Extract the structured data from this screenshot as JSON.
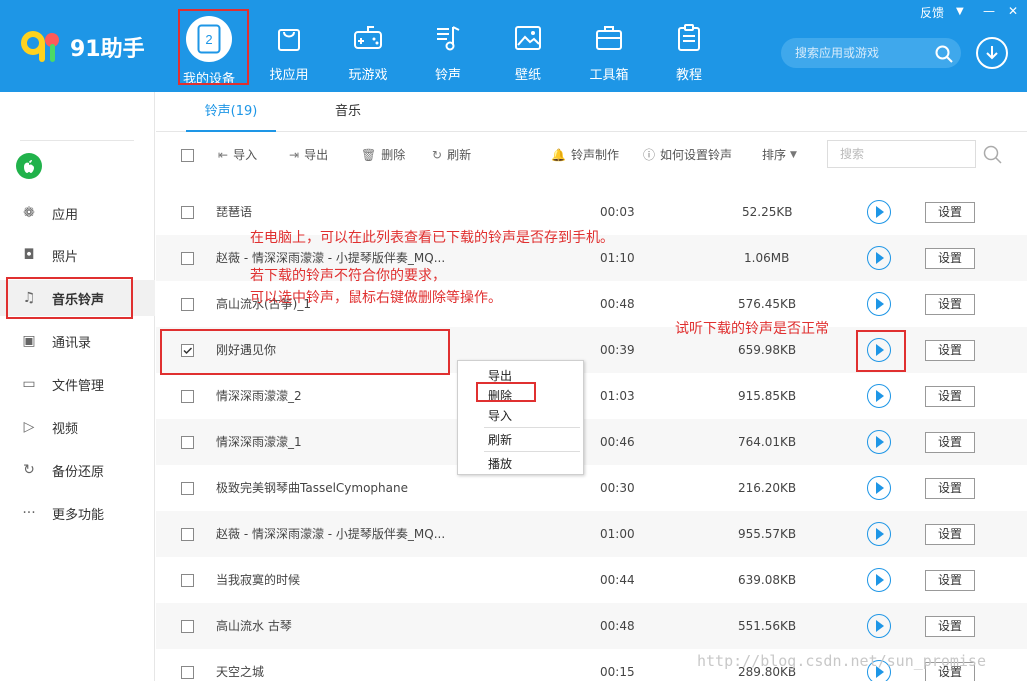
{
  "app": {
    "name": "91助手"
  },
  "topbar": {
    "nav": [
      {
        "label": "我的设备",
        "icon": "device-icon",
        "badge": "2"
      },
      {
        "label": "找应用",
        "icon": "bag-icon"
      },
      {
        "label": "玩游戏",
        "icon": "gamepad-icon"
      },
      {
        "label": "铃声",
        "icon": "music-note-icon"
      },
      {
        "label": "壁纸",
        "icon": "picture-icon"
      },
      {
        "label": "工具箱",
        "icon": "toolbox-icon"
      },
      {
        "label": "教程",
        "icon": "clipboard-icon"
      }
    ],
    "feedback": "反馈",
    "search_placeholder": "搜索应用或游戏"
  },
  "sidebar": {
    "items": [
      {
        "label": "应用",
        "icon": "apps-icon"
      },
      {
        "label": "照片",
        "icon": "camera-icon"
      },
      {
        "label": "音乐铃声",
        "icon": "music-icon"
      },
      {
        "label": "通讯录",
        "icon": "contacts-icon"
      },
      {
        "label": "文件管理",
        "icon": "folder-icon"
      },
      {
        "label": "视频",
        "icon": "video-icon"
      },
      {
        "label": "备份还原",
        "icon": "refresh-icon"
      },
      {
        "label": "更多功能",
        "icon": "more-icon"
      }
    ]
  },
  "tabs": [
    {
      "label": "铃声(19)"
    },
    {
      "label": "音乐"
    }
  ],
  "toolbar": {
    "import": "导入",
    "export": "导出",
    "delete": "删除",
    "refresh": "刷新",
    "make_ringtone": "铃声制作",
    "how_to_set": "如何设置铃声",
    "sort": "排序",
    "search_placeholder": "搜索"
  },
  "rows": [
    {
      "name": "琵琶语",
      "duration": "00:03",
      "size": "52.25KB",
      "checked": false
    },
    {
      "name": "赵薇 - 情深深雨濛濛 - 小提琴版伴奏_MQ...",
      "duration": "01:10",
      "size": "1.06MB",
      "checked": false
    },
    {
      "name": "高山流水(古筝)_1",
      "duration": "00:48",
      "size": "576.45KB",
      "checked": false
    },
    {
      "name": "刚好遇见你",
      "duration": "00:39",
      "size": "659.98KB",
      "checked": true
    },
    {
      "name": "情深深雨濛濛_2",
      "duration": "01:03",
      "size": "915.85KB",
      "checked": false
    },
    {
      "name": "情深深雨濛濛_1",
      "duration": "00:46",
      "size": "764.01KB",
      "checked": false
    },
    {
      "name": "极致完美钢琴曲TasselCymophane",
      "duration": "00:30",
      "size": "216.20KB",
      "checked": false
    },
    {
      "name": "赵薇 - 情深深雨濛濛 - 小提琴版伴奏_MQ...",
      "duration": "01:00",
      "size": "955.57KB",
      "checked": false
    },
    {
      "name": "当我寂寞的时候",
      "duration": "00:44",
      "size": "639.08KB",
      "checked": false
    },
    {
      "name": "高山流水 古琴",
      "duration": "00:48",
      "size": "551.56KB",
      "checked": false
    },
    {
      "name": "天空之城",
      "duration": "00:15",
      "size": "289.80KB",
      "checked": false
    }
  ],
  "row_button": "设置",
  "context_menu": {
    "items": [
      "导出",
      "删除",
      "导入",
      "刷新",
      "播放"
    ]
  },
  "annotations": {
    "line1": "在电脑上，可以在此列表查看已下载的铃声是否存到手机。",
    "line2": "若下载的铃声不符合你的要求，",
    "line3": "可以选中铃声，鼠标右键做删除等操作。",
    "play_note": "试听下载的铃声是否正常"
  },
  "watermark": "http://blog.csdn.net/sun_promise",
  "colors": {
    "brand": "#1e96e6",
    "annotation": "#e03030"
  }
}
